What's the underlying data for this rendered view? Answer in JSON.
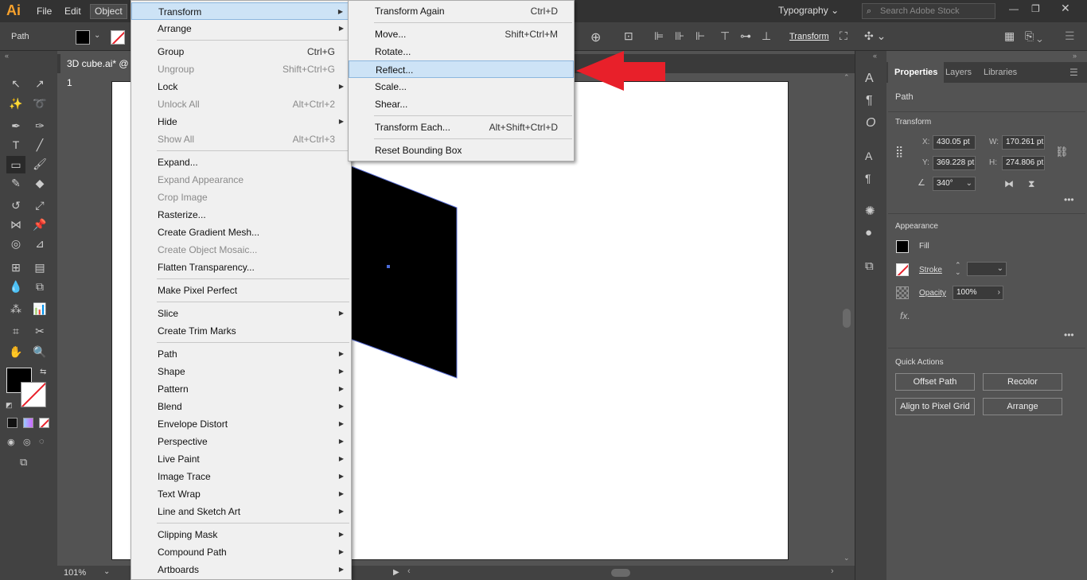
{
  "app": {
    "logo": "Ai"
  },
  "menubar": {
    "items": [
      "File",
      "Edit",
      "Object"
    ],
    "workspace": "Typography",
    "search_placeholder": "Search Adobe Stock"
  },
  "control": {
    "selection": "Path",
    "transform_label": "Transform"
  },
  "document": {
    "tab": "3D cube.ai* @ 1",
    "zoom": "101%"
  },
  "object_menu": {
    "groups": [
      [
        {
          "label": "Transform",
          "sub": true,
          "hl": true
        },
        {
          "label": "Arrange",
          "sub": true
        }
      ],
      [
        {
          "label": "Group",
          "sc": "Ctrl+G"
        },
        {
          "label": "Ungroup",
          "sc": "Shift+Ctrl+G",
          "dis": true
        },
        {
          "label": "Lock",
          "sub": true
        },
        {
          "label": "Unlock All",
          "sc": "Alt+Ctrl+2",
          "dis": true
        },
        {
          "label": "Hide",
          "sub": true
        },
        {
          "label": "Show All",
          "sc": "Alt+Ctrl+3",
          "dis": true
        }
      ],
      [
        {
          "label": "Expand..."
        },
        {
          "label": "Expand Appearance",
          "dis": true
        },
        {
          "label": "Crop Image",
          "dis": true
        },
        {
          "label": "Rasterize..."
        },
        {
          "label": "Create Gradient Mesh..."
        },
        {
          "label": "Create Object Mosaic...",
          "dis": true
        },
        {
          "label": "Flatten Transparency..."
        }
      ],
      [
        {
          "label": "Make Pixel Perfect"
        }
      ],
      [
        {
          "label": "Slice",
          "sub": true
        },
        {
          "label": "Create Trim Marks"
        }
      ],
      [
        {
          "label": "Path",
          "sub": true
        },
        {
          "label": "Shape",
          "sub": true
        },
        {
          "label": "Pattern",
          "sub": true
        },
        {
          "label": "Blend",
          "sub": true
        },
        {
          "label": "Envelope Distort",
          "sub": true
        },
        {
          "label": "Perspective",
          "sub": true
        },
        {
          "label": "Live Paint",
          "sub": true
        },
        {
          "label": "Image Trace",
          "sub": true
        },
        {
          "label": "Text Wrap",
          "sub": true
        },
        {
          "label": "Line and Sketch Art",
          "sub": true
        }
      ],
      [
        {
          "label": "Clipping Mask",
          "sub": true
        },
        {
          "label": "Compound Path",
          "sub": true
        },
        {
          "label": "Artboards",
          "sub": true
        }
      ]
    ]
  },
  "transform_menu": {
    "groups": [
      [
        {
          "label": "Transform Again",
          "sc": "Ctrl+D"
        }
      ],
      [
        {
          "label": "Move...",
          "sc": "Shift+Ctrl+M"
        },
        {
          "label": "Rotate..."
        },
        {
          "label": "Reflect...",
          "hl": true
        },
        {
          "label": "Scale..."
        },
        {
          "label": "Shear..."
        }
      ],
      [
        {
          "label": "Transform Each...",
          "sc": "Alt+Shift+Ctrl+D"
        }
      ],
      [
        {
          "label": "Reset Bounding Box"
        }
      ]
    ]
  },
  "panel": {
    "tabs": [
      "Properties",
      "Layers",
      "Libraries"
    ],
    "selection": "Path",
    "transform": {
      "title": "Transform",
      "x_label": "X:",
      "x": "430.05 pt",
      "y_label": "Y:",
      "y": "369.228 pt",
      "w_label": "W:",
      "w": "170.261 pt",
      "h_label": "H:",
      "h": "274.806 pt",
      "angle": "340°"
    },
    "appearance": {
      "title": "Appearance",
      "fill": "Fill",
      "stroke": "Stroke",
      "opacity_label": "Opacity",
      "opacity": "100%",
      "fx": "fx."
    },
    "quick_actions": {
      "title": "Quick Actions",
      "buttons": [
        "Offset Path",
        "Recolor",
        "Align to Pixel Grid",
        "Arrange"
      ]
    }
  },
  "colors": {
    "menu_bg": "#f0f0f0",
    "highlight": "#cde3f6",
    "arrow": "#e8202a",
    "panel": "#535353"
  }
}
